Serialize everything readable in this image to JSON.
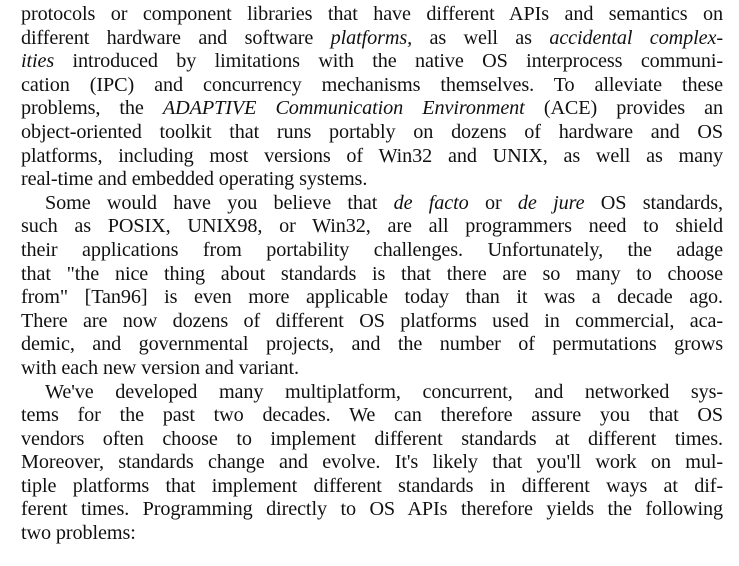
{
  "paragraphs": [
    {
      "lines": [
        [
          "protocols or component libraries that have different APIs and semantics on"
        ],
        [
          "different hardware and software ",
          {
            "i": "platforms,"
          },
          " as well as ",
          {
            "i": "accidental complex-"
          }
        ],
        [
          {
            "i": "ities"
          },
          " introduced by limitations with the native OS interprocess communi-"
        ],
        [
          "cation (IPC) and concurrency mechanisms themselves. To alleviate these"
        ],
        [
          "problems, the ",
          {
            "i": "ADAPTIVE Communication Environment"
          },
          " (ACE) provides an"
        ],
        [
          "object-oriented toolkit that runs portably on dozens of hardware and OS"
        ],
        [
          "platforms, including most versions of Win32 and UNIX, as well as many"
        ],
        [
          "real-time and embedded operating systems."
        ]
      ]
    },
    {
      "lines": [
        [
          "Some would have you believe that ",
          {
            "i": "de facto"
          },
          " or ",
          {
            "i": "de jure"
          },
          " OS standards,"
        ],
        [
          "such as POSIX, UNIX98, or Win32, are all programmers need to shield"
        ],
        [
          "their applications from portability challenges. Unfortunately, the adage"
        ],
        [
          "that \"the nice thing about standards is that there are so many to choose"
        ],
        [
          "from\" [Tan96] is even more applicable today than it was a decade ago."
        ],
        [
          "There are now dozens of different OS platforms used in commercial, aca-"
        ],
        [
          "demic, and governmental projects, and the number of permutations grows"
        ],
        [
          "with each new version and variant."
        ]
      ]
    },
    {
      "lines": [
        [
          "We've developed many multiplatform, concurrent, and networked sys-"
        ],
        [
          "tems for the past two decades. We can therefore assure you that OS"
        ],
        [
          "vendors often choose to implement different standards at different times."
        ],
        [
          "Moreover, standards change and evolve. It's likely that you'll work on mul-"
        ],
        [
          "tiple platforms that implement different standards in different ways at dif-"
        ],
        [
          "ferent times. Programming directly to OS APIs therefore yields the following"
        ],
        [
          "two problems:"
        ]
      ]
    }
  ]
}
